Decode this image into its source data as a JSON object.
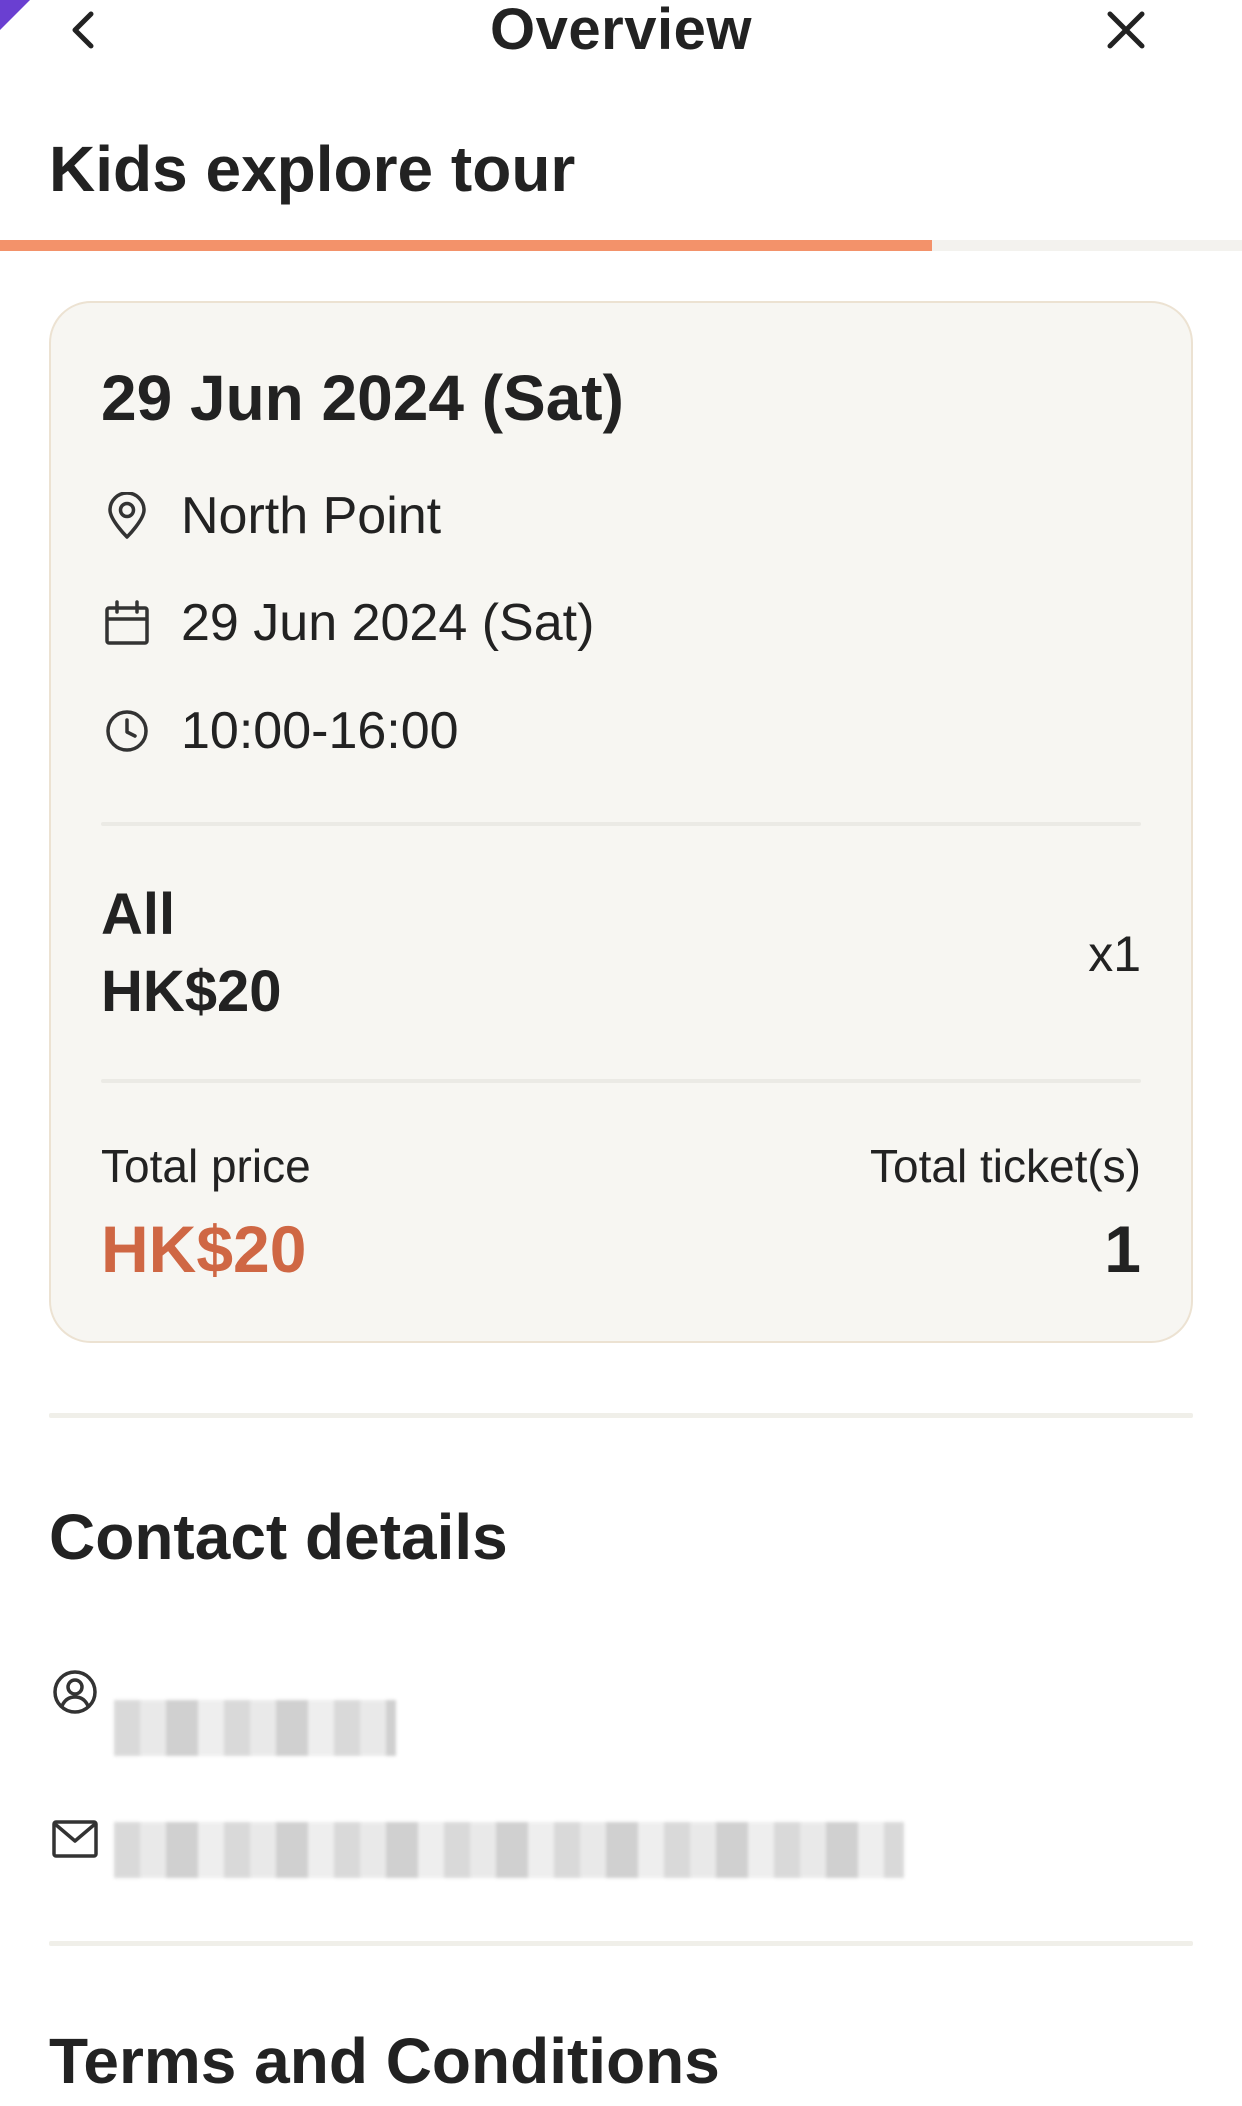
{
  "header": {
    "title": "Overview",
    "back_icon": "chevron-left-icon",
    "close_icon": "close-icon",
    "corner_accent_color": "#6a3fd1"
  },
  "tour": {
    "title": "Kids explore tour",
    "progress_fraction": 0.75,
    "progress_color": "#f3926a"
  },
  "summary": {
    "date_heading": "29 Jun 2024 (Sat)",
    "location": "North Point",
    "date": "29 Jun 2024 (Sat)",
    "time": "10:00-16:00",
    "ticket": {
      "name": "All",
      "price": "HK$20",
      "quantity": "x1"
    },
    "total_price_label": "Total price",
    "total_price_value": "HK$20",
    "total_price_color": "#cf6744",
    "total_tickets_label": "Total ticket(s)",
    "total_tickets_value": "1"
  },
  "contact": {
    "title": "Contact details",
    "name_icon": "user-circle-icon",
    "email_icon": "mail-icon"
  },
  "terms": {
    "title": "Terms and Conditions"
  }
}
